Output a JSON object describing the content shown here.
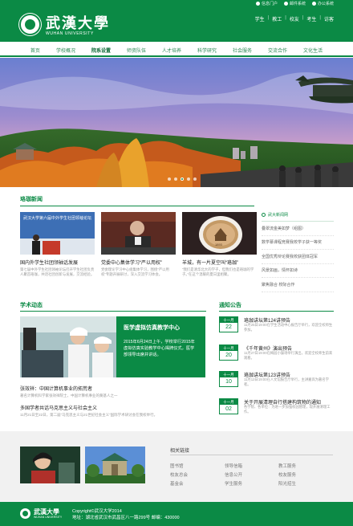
{
  "colors": {
    "brand": "#0b8a45"
  },
  "toplinks": [
    "信息门户",
    "邮件系统",
    "办公系统"
  ],
  "brand": {
    "cn": "武漢大學",
    "en": "WUHAN UNIVERSITY"
  },
  "quick": [
    "学生",
    "教工",
    "校友",
    "考生",
    "访客"
  ],
  "nav": [
    "首页",
    "学校概况",
    "院系设置",
    "师资队伍",
    "人才培养",
    "科学研究",
    "社会服务",
    "交流合作",
    "文化生活"
  ],
  "nav_active": "院系设置",
  "hero": {
    "slides": 5,
    "current": 2
  },
  "news": {
    "title": "珞珈新闻",
    "items": [
      {
        "title": "国内外学生社团领袖话发展",
        "summary": "第七届中外学生社团领袖论坛召开学生社团负责人聚首珞珈，共话社团创新与发展，交流经验。",
        "image_text": "武汉大学第六届中外学生社团领袖论坛"
      },
      {
        "title": "党委中心集体学习“严以用权”",
        "summary": "党委理论学习中心组集体学习，围绕“严以用权”专题开展研讨，深入交流学习体会。",
        "image_text": ""
      },
      {
        "title": "羊城，有一片夏空叫“珞珈”",
        "summary": "“我们是清华北大的学子，但我们也是珞珈的学子。”在这个温暖的夏日里相聚。",
        "image_text": ""
      }
    ],
    "side": {
      "title": "武大新闻网",
      "items": [
        "叠翠流金美如梦（组图）",
        "数学慕课程竞赛我校学子获一等奖",
        "全国优秀辩论赛我校获团体冠军",
        "风景如画，情怀如诗",
        "聚焦融合 校际合作"
      ]
    }
  },
  "academic": {
    "title": "学术动态",
    "feature": {
      "title": "医学虚拟仿真教学中心",
      "text": "2015年6月24日上午，学校举行2015年虚拟仿真实验教学中心揭牌仪式，医学部领导出席并讲话。"
    },
    "items": [
      {
        "title": "张效祥：中国计算机事业的拓荒者",
        "summary": "著名计算机科学家张效祥院士，中国计算机事业的奠基人之一"
      },
      {
        "title": "多国学者共话马克思主义与社会主义",
        "summary": "11月21日至22日，第二届“马克思主义与21世纪社会主义”国际学术研讨会在我校举行。"
      }
    ]
  },
  "notices": {
    "title": "通知公告",
    "items": [
      {
        "month": "十一月",
        "day": "22",
        "title": "珞珈讲坛第124讲预告",
        "summary": "11月25日19:00在学生活动中心报告厅举行，欢迎全校师生参加。"
      },
      {
        "month": "十一月",
        "day": "20",
        "title": "《千年黄州》演出预告",
        "summary": "11月27日19:00在梅园小操场举行演出，欢迎全校师生前来观看。"
      },
      {
        "month": "十一月",
        "day": "10",
        "title": "珞珈讲坛第123讲预告",
        "summary": "11月12日19:00在人文馆报告厅举行，主讲嘉宾为著名学者。"
      },
      {
        "month": "十一月",
        "day": "02",
        "title": "关于开展清理自行搭建构筑物的通知",
        "summary": "各学院、各单位：为进一步加强校园管理，现开展清理工作。"
      }
    ]
  },
  "links": {
    "title": "相关链接",
    "items": [
      "图书馆",
      "领导信箱",
      "教工服务",
      "校友总会",
      "信息公开",
      "校友服务",
      "基金会",
      "学生服务",
      "阳光招生"
    ]
  },
  "footer": {
    "name": "武漢大學",
    "en": "WUHAN UNIVERSITY",
    "copyright": "Copyright©武汉大学2014",
    "address": "地址：湖北省武汉市武昌区八一路299号 邮编：430000"
  }
}
